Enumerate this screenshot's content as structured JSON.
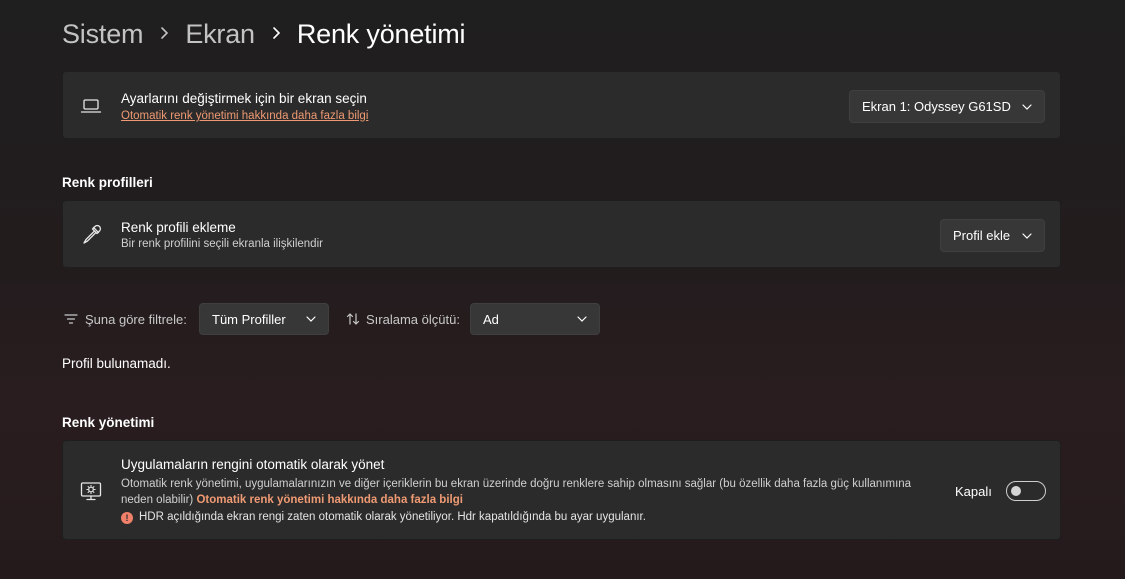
{
  "breadcrumb": {
    "items": [
      "Sistem",
      "Ekran"
    ],
    "current": "Renk yönetimi"
  },
  "display_select": {
    "title": "Ayarlarını değiştirmek için bir ekran seçin",
    "link": "Otomatik renk yönetimi hakkında daha fazla bilgi",
    "dropdown_value": "Ekran 1: Odyssey G61SD"
  },
  "profiles": {
    "section_title": "Renk profilleri",
    "add_card": {
      "title": "Renk profili ekleme",
      "subtitle": "Bir renk profilini seçili ekranla ilişkilendir",
      "button": "Profil ekle"
    },
    "filter_label": "Şuna göre filtrele:",
    "filter_value": "Tüm Profiller",
    "sort_label": "Sıralama ölçütü:",
    "sort_value": "Ad",
    "empty_message": "Profil bulunamadı."
  },
  "color_management": {
    "section_title": "Renk yönetimi",
    "auto_card": {
      "title": "Uygulamaların rengini otomatik olarak yönet",
      "description": "Otomatik renk yönetimi, uygulamalarınızın ve diğer içeriklerin bu ekran üzerinde doğru renklere sahip olmasını sağlar (bu özellik daha fazla güç kullanımına neden olabilir)",
      "link": "Otomatik renk yönetimi hakkında daha fazla bilgi",
      "warning": "HDR açıldığında ekran rengi zaten otomatik olarak yönetiliyor. Hdr kapatıldığında bu ayar uygulanır.",
      "toggle_label": "Kapalı",
      "toggle_on": false
    }
  },
  "icons": {
    "display": "laptop-icon",
    "profile": "eyedropper-icon",
    "auto_color": "display-brightness-icon",
    "filter": "filter-icon",
    "sort": "sort-arrows-icon",
    "warning": "error-circle-icon",
    "chevron": "chevron-down-icon"
  },
  "colors": {
    "accent_link": "#ef9a73",
    "card_bg": "#2b2b2b",
    "warning": "#f0806a"
  }
}
